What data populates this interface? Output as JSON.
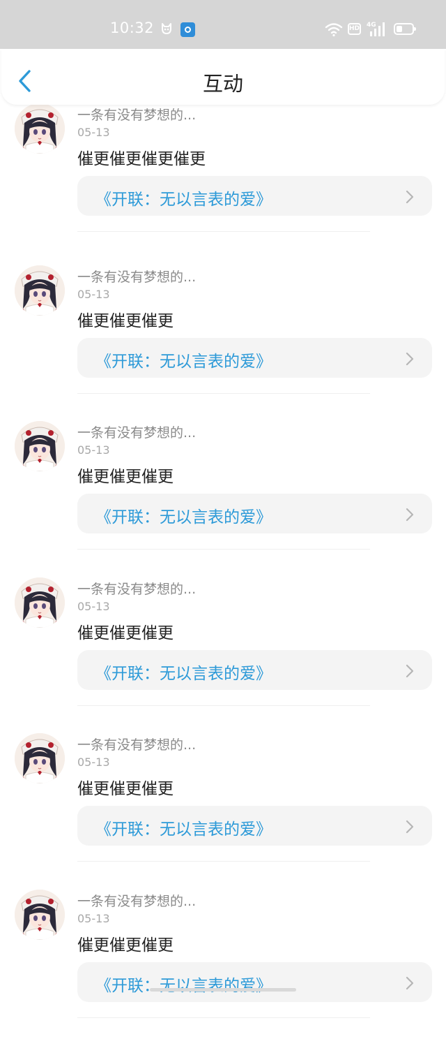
{
  "status_bar": {
    "time": "10:32",
    "hd_label": "HD",
    "network": "4G",
    "icons": [
      "cat-icon",
      "app-icon",
      "wifi-icon",
      "hd-icon",
      "signal-icon",
      "battery-icon"
    ]
  },
  "header": {
    "title": "互动",
    "back_icon": "chevron-left-icon"
  },
  "colors": {
    "accent": "#2d9ad8",
    "statusbar_bg": "#d6d6d6",
    "card_bg": "#f4f4f4"
  },
  "items": [
    {
      "username": "一条有没有梦想的...",
      "date": "05-13",
      "comment": "催更催更催更催更",
      "book": "《开联：无以言表的爱》"
    },
    {
      "username": "一条有没有梦想的...",
      "date": "05-13",
      "comment": "催更催更催更",
      "book": "《开联：无以言表的爱》"
    },
    {
      "username": "一条有没有梦想的...",
      "date": "05-13",
      "comment": "催更催更催更",
      "book": "《开联：无以言表的爱》"
    },
    {
      "username": "一条有没有梦想的...",
      "date": "05-13",
      "comment": "催更催更催更",
      "book": "《开联：无以言表的爱》"
    },
    {
      "username": "一条有没有梦想的...",
      "date": "05-13",
      "comment": "催更催更催更",
      "book": "《开联：无以言表的爱》"
    },
    {
      "username": "一条有没有梦想的...",
      "date": "05-13",
      "comment": "催更催更催更",
      "book": "《开联：无以言表的爱》"
    }
  ]
}
